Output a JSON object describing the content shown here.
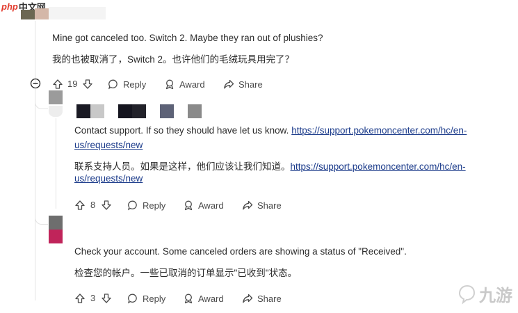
{
  "watermark_top": {
    "brand": "php",
    "site": "中文网"
  },
  "comments": [
    {
      "en": "Mine got canceled too. Switch 2. Maybe they ran out of plushies?",
      "zh": "我的也被取消了，Switch 2。也许他们的毛绒玩具用完了？",
      "votes": "19",
      "reply_label": "Reply",
      "award_label": "Award",
      "share_label": "Share"
    },
    {
      "en_prefix": "Contact support. If so they should have let us know. ",
      "en_link_a": "https://support.pokemoncenter.com/hc/en-",
      "en_link_b": "us/requests/new",
      "zh_prefix": "联系支持人员。如果是这样，他们应该让我们知道。",
      "zh_link_a": "https://support.pokemoncenter.com/hc/en-",
      "zh_link_b": "us/requests/new",
      "votes": "8",
      "reply_label": "Reply",
      "award_label": "Award",
      "share_label": "Share"
    },
    {
      "en": "Check your account. Some canceled orders are showing a status of \"Received\".",
      "zh": "检查您的帐户。一些已取消的订单显示\"已收到\"状态。",
      "votes": "3",
      "reply_label": "Reply",
      "award_label": "Award",
      "share_label": "Share"
    }
  ],
  "watermark_bottom": "九游",
  "colors": {
    "thread": "#e3e3e3",
    "text": "#2a2a2a",
    "link": "#1a3a8a",
    "action": "#4a4a4a",
    "php_red": "#e23a2c",
    "avatar_pink": "#c0245a"
  }
}
